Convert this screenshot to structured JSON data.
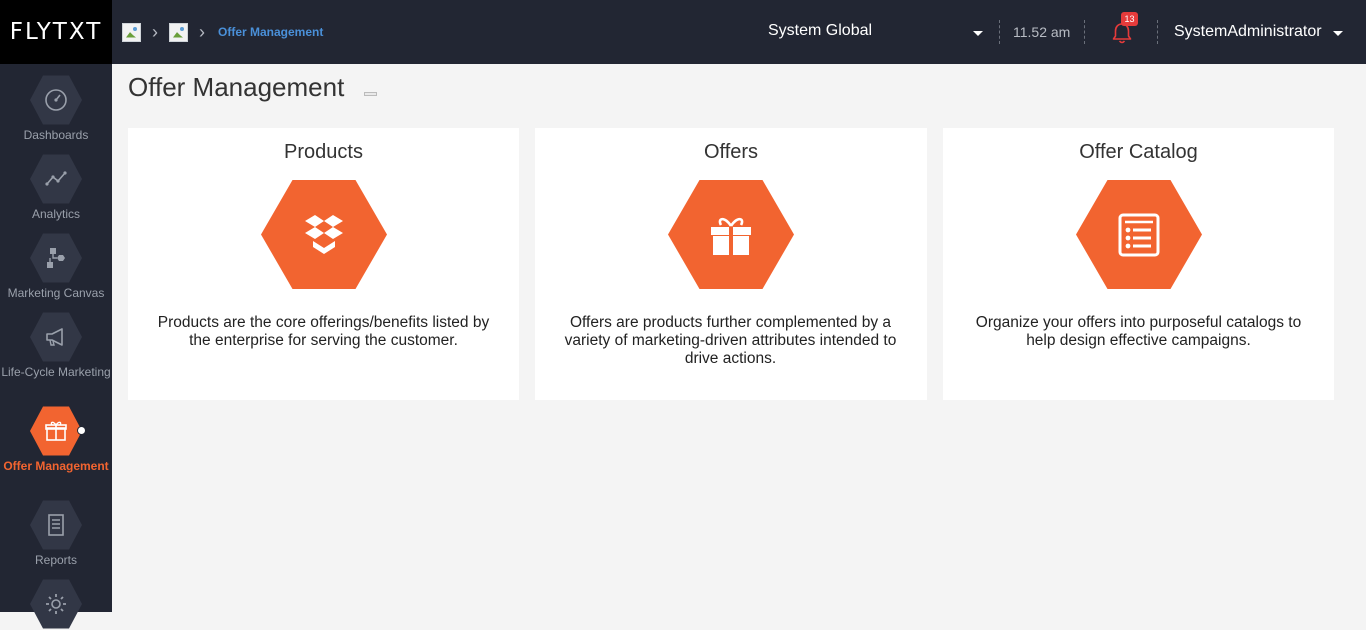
{
  "app": {
    "logo": "FLYTXT"
  },
  "breadcrumb": {
    "current": "Offer Management"
  },
  "header": {
    "scope": "System Global",
    "time": "11.52 am",
    "notifications_count": "13",
    "user": "SystemAdministrator"
  },
  "sidebar": {
    "items": [
      {
        "label": "Dashboards",
        "icon": "gauge-icon"
      },
      {
        "label": "Analytics",
        "icon": "line-graph-icon"
      },
      {
        "label": "Marketing Canvas",
        "icon": "flowchart-icon"
      },
      {
        "label": "Life-Cycle Marketing",
        "icon": "megaphone-icon"
      },
      {
        "label": "Offer Management",
        "icon": "gift-icon",
        "active": true
      },
      {
        "label": "Reports",
        "icon": "document-icon"
      },
      {
        "label": "",
        "icon": "gear-icon"
      }
    ]
  },
  "page": {
    "title": "Offer Management"
  },
  "cards": [
    {
      "title": "Products",
      "icon": "dropbox-box-icon",
      "description": "Products are the core offerings/benefits listed by the enterprise for serving the customer."
    },
    {
      "title": "Offers",
      "icon": "gift-icon",
      "description": "Offers are products further complemented by a variety of marketing-driven attributes intended to drive actions."
    },
    {
      "title": "Offer Catalog",
      "icon": "list-icon",
      "description": "Organize your offers into purposeful catalogs to help design effective campaigns."
    }
  ],
  "colors": {
    "accent": "#f26430",
    "topbar": "#222633",
    "link": "#4a90d9"
  }
}
